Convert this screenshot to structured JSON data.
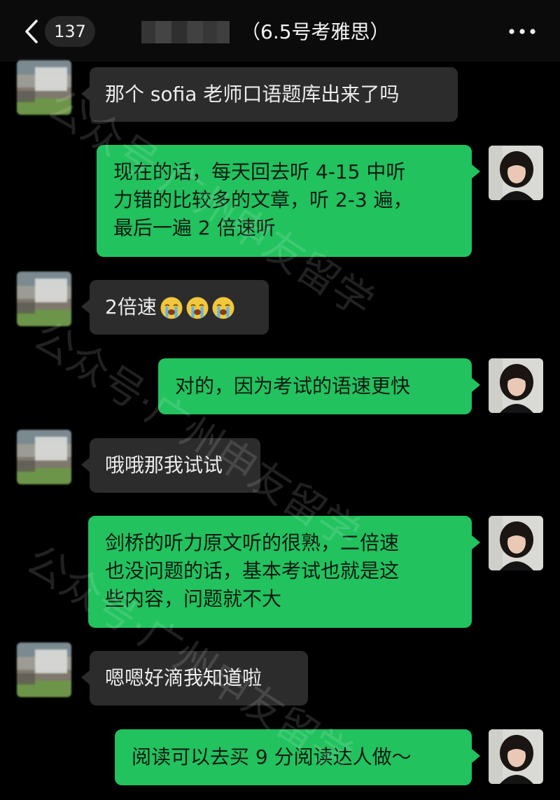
{
  "header": {
    "back_icon": "chevron-left-icon",
    "unread_count": "137",
    "title": "（6.5号考雅思）",
    "more_icon": "more-dots-icon"
  },
  "messages": [
    {
      "side": "incoming",
      "text": "那个 sofia 老师口语题库出来了吗"
    },
    {
      "side": "outgoing",
      "text": "现在的话，每天回去听 4-15 中听\n力错的比较多的文章，听 2-3 遍，\n最后一遍 2 倍速听"
    },
    {
      "side": "incoming",
      "text": "2倍速",
      "emojis": [
        "crying-face-emoji",
        "crying-face-emoji",
        "crying-face-emoji"
      ]
    },
    {
      "side": "outgoing",
      "text": "对的，因为考试的语速更快"
    },
    {
      "side": "incoming",
      "text": "哦哦那我试试"
    },
    {
      "side": "outgoing",
      "text": "剑桥的听力原文听的很熟，二倍速\n也没问题的话，基本考试也就是这\n些内容，问题就不大"
    },
    {
      "side": "incoming",
      "text": "嗯嗯好滴我知道啦"
    },
    {
      "side": "outgoing",
      "text": "阅读可以去买 9 分阅读达人做～"
    }
  ],
  "watermarks": [
    "公众号·广州申友留学",
    "公众号·广州申友留学",
    "公众号·广州申友留学"
  ],
  "colors": {
    "background": "#000000",
    "incoming_bubble": "#2c2c2c",
    "outgoing_bubble": "#22c25f"
  }
}
